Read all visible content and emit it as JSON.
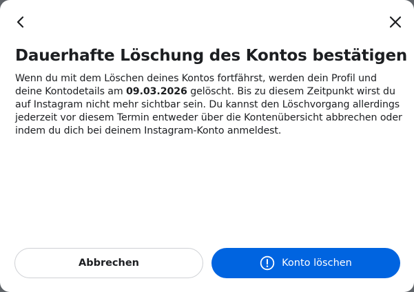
{
  "header": {
    "back_icon": "chevron-left-icon",
    "close_icon": "close-icon"
  },
  "dialog": {
    "title": "Dauerhafte Löschung des Kontos bestätigen",
    "body_before_date": "Wenn du mit dem Löschen deines Kontos fortfährst, werden dein Profil und deine Kontodetails am ",
    "date": "09.03.2026",
    "body_after_date": " gelöscht. Bis zu diesem Zeitpunkt wirst du auf Instagram nicht mehr sichtbar sein. Du kannst den Löschvorgang allerdings jederzeit vor diesem Termin entweder über die Kontenübersicht abbrechen oder indem du dich bei deinem Instagram-Konto anmeldest."
  },
  "actions": {
    "cancel_label": "Abbrechen",
    "delete_label": "Konto löschen",
    "delete_icon": "alert-circle-icon"
  },
  "colors": {
    "primary": "#0064e0",
    "text": "#1c1e21",
    "border": "#ced0d4"
  }
}
